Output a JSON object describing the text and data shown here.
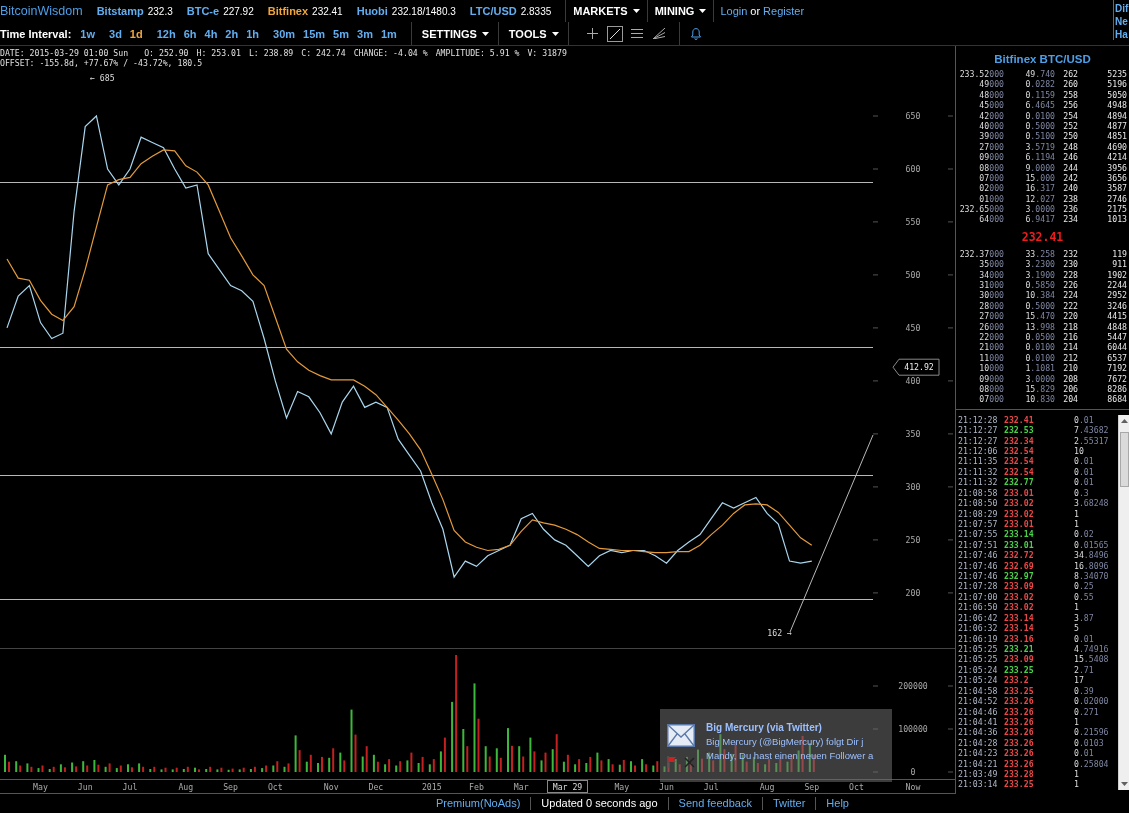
{
  "header": {
    "logo": "BitcoinWisdom",
    "markets": [
      {
        "name": "Bitstamp",
        "price": "232.3",
        "selected": false
      },
      {
        "name": "BTC-e",
        "price": "227.92",
        "selected": false
      },
      {
        "name": "Bitfinex",
        "price": "232.41",
        "selected": true
      },
      {
        "name": "Huobi",
        "price": "232.18/1480.3",
        "selected": false
      },
      {
        "name": "LTC/USD",
        "price": "2.8335",
        "selected": false
      }
    ],
    "menus": [
      "MARKETS",
      "MINING"
    ],
    "account": {
      "login": "Login",
      "or": "or",
      "register": "Register"
    }
  },
  "corner_panel": {
    "lines": [
      "Dif",
      "Ne",
      "Ha"
    ]
  },
  "toolbar": {
    "interval_label": "Time Interval:",
    "interval_groups": [
      [
        {
          "label": "1w",
          "selected": false
        }
      ],
      [
        {
          "label": "3d",
          "selected": false
        },
        {
          "label": "1d",
          "selected": true
        }
      ],
      [
        {
          "label": "12h",
          "selected": false
        },
        {
          "label": "6h",
          "selected": false
        },
        {
          "label": "4h",
          "selected": false
        },
        {
          "label": "2h",
          "selected": false
        },
        {
          "label": "1h",
          "selected": false
        }
      ],
      [
        {
          "label": "30m",
          "selected": false
        },
        {
          "label": "15m",
          "selected": false
        },
        {
          "label": "5m",
          "selected": false
        },
        {
          "label": "3m",
          "selected": false
        },
        {
          "label": "1m",
          "selected": false
        }
      ]
    ],
    "menus": [
      "SETTINGS",
      "TOOLS"
    ],
    "tools": [
      {
        "kind": "crosshair",
        "selected": false
      },
      {
        "kind": "line",
        "selected": true
      },
      {
        "kind": "hlines",
        "selected": false
      },
      {
        "kind": "fan",
        "selected": false
      }
    ]
  },
  "price_chart": {
    "info": [
      "DATE: 2015-03-29 01:00 Sun",
      "O: 252.90",
      "H: 253.01",
      "L: 238.89",
      "C: 242.74",
      "CHANGE: -4.04 %",
      "AMPLITUDE: 5.91 %",
      "V: 31879"
    ],
    "offset": "OFFSET: -155.8d, +77.67% / -43.72%, 180.5",
    "cursor_label": "412.92",
    "chart_data": {
      "type": "line",
      "categories": [
        null,
        null,
        null,
        null,
        null,
        null,
        null,
        null,
        null,
        null,
        null,
        null,
        null,
        null,
        null,
        null,
        null,
        null,
        null,
        null,
        null,
        null,
        null,
        null,
        null,
        null,
        null,
        null,
        null,
        null,
        null,
        null,
        null,
        null,
        null,
        null,
        null,
        null,
        null,
        null,
        null,
        null,
        null,
        null,
        null,
        null,
        null,
        null,
        null,
        null,
        null,
        null,
        null,
        null,
        null,
        null,
        null,
        null,
        null,
        null,
        null,
        null,
        null,
        null,
        null,
        null,
        null,
        null,
        null,
        null,
        null,
        null,
        null
      ],
      "series": [
        {
          "color": "#a9d6ee",
          "values": [
            450,
            480,
            490,
            455,
            440,
            445,
            560,
            640,
            650,
            600,
            585,
            600,
            630,
            625,
            620,
            600,
            582,
            585,
            520,
            505,
            490,
            485,
            475,
            440,
            400,
            365,
            390,
            385,
            370,
            350,
            380,
            395,
            375,
            380,
            375,
            345,
            330,
            315,
            285,
            260,
            215,
            230,
            225,
            235,
            240,
            245,
            270,
            275,
            260,
            250,
            245,
            235,
            225,
            235,
            240,
            238,
            240,
            240,
            235,
            228,
            240,
            248,
            255,
            270,
            285,
            280,
            285,
            290,
            275,
            265,
            230,
            228,
            230
          ]
        },
        {
          "color": "#e39a3c",
          "values": [
            515,
            497,
            495,
            476,
            463,
            457,
            470,
            505,
            545,
            585,
            590,
            592,
            605,
            612,
            618,
            617,
            603,
            597,
            585,
            560,
            535,
            518,
            500,
            490,
            460,
            430,
            418,
            410,
            405,
            401,
            401,
            401,
            395,
            387,
            375,
            363,
            350,
            335,
            312,
            288,
            259,
            248,
            243,
            240,
            241,
            245,
            258,
            269,
            266,
            264,
            260,
            255,
            248,
            242,
            241,
            240,
            240,
            239,
            238,
            238,
            239,
            239,
            245,
            255,
            264,
            275,
            283,
            284,
            283,
            276,
            264,
            252,
            245
          ]
        }
      ],
      "ylim": [
        200,
        650
      ],
      "yticks": [
        200,
        250,
        300,
        350,
        400,
        450,
        500,
        550,
        600,
        650
      ],
      "annotations": [
        "← 685",
        "162 →"
      ]
    }
  },
  "volume_chart": {
    "cursor_label": "Mar 29",
    "end_label": "Now",
    "chart_data": {
      "type": "bar",
      "categories": [
        null,
        null,
        null,
        "May",
        null,
        null,
        null,
        "Jun",
        null,
        null,
        null,
        "Jul",
        null,
        null,
        null,
        null,
        "Aug",
        null,
        null,
        null,
        "Sep",
        null,
        null,
        null,
        "Oct",
        null,
        null,
        null,
        null,
        "Nov",
        null,
        null,
        null,
        "Dec",
        null,
        null,
        null,
        null,
        "2015",
        null,
        null,
        null,
        "Feb",
        null,
        null,
        null,
        "Mar",
        null,
        null,
        null,
        null,
        null,
        null,
        null,
        null,
        "May",
        null,
        null,
        null,
        "Jun",
        null,
        null,
        null,
        "Jul",
        null,
        null,
        null,
        null,
        "Aug",
        null,
        null,
        null,
        "Sep",
        null,
        null,
        null,
        "Oct"
      ],
      "series": [
        {
          "color": "#3cb83c",
          "values": [
            40000,
            25000,
            20000,
            9000,
            7000,
            18000,
            22000,
            25000,
            28000,
            12000,
            9000,
            18000,
            20000,
            7000,
            6000,
            6000,
            7000,
            10000,
            7000,
            6000,
            5000,
            6000,
            7000,
            9000,
            15000,
            12000,
            85000,
            24000,
            21000,
            33000,
            45000,
            145000,
            36000,
            40000,
            18000,
            15000,
            27000,
            21000,
            18000,
            48000,
            163000,
            100000,
            206000,
            60000,
            55000,
            102000,
            60000,
            80000,
            27000,
            53000,
            24000,
            18000,
            21000,
            45000,
            30000,
            17000,
            25000,
            30000,
            15000,
            13000,
            30000,
            35000,
            52000,
            45000,
            88000,
            42000,
            40000,
            35000,
            18000,
            21000,
            24000,
            50000,
            67000,
            null,
            null,
            null,
            null
          ]
        },
        {
          "color": "#c42020",
          "values": [
            24000,
            15000,
            12000,
            15000,
            12000,
            11000,
            13000,
            15000,
            17000,
            20000,
            15000,
            11000,
            12000,
            12000,
            10000,
            10000,
            12000,
            6000,
            12000,
            10000,
            8000,
            10000,
            12000,
            15000,
            25000,
            20000,
            51000,
            40000,
            35000,
            55000,
            27000,
            87000,
            60000,
            24000,
            30000,
            25000,
            45000,
            35000,
            30000,
            80000,
            272000,
            60000,
            124000,
            36000,
            33000,
            61000,
            36000,
            48000,
            45000,
            88000,
            40000,
            30000,
            35000,
            27000,
            18000,
            28000,
            15000,
            18000,
            25000,
            22000,
            18000,
            21000,
            31000,
            27000,
            53000,
            70000,
            24000,
            21000,
            30000,
            35000,
            40000,
            84000,
            40000,
            null,
            null,
            null,
            null
          ]
        }
      ],
      "ylim": [
        0,
        286000
      ],
      "yticks": [
        {
          "value": 0,
          "label": "0"
        },
        {
          "value": 100000,
          "label": "100000"
        },
        {
          "value": 200000,
          "label": "200000"
        }
      ]
    }
  },
  "order_book": {
    "title": "Bitfinex BTC/USD",
    "asks": [
      {
        "column_1": [
          "233.52",
          "000"
        ],
        "column_2": [
          "49",
          ".740"
        ],
        "column_3": "262",
        "column_4": "5235"
      },
      {
        "column_1": [
          "49",
          "000"
        ],
        "column_2": [
          "0",
          ".0282"
        ],
        "column_3": "260",
        "column_4": "5196"
      },
      {
        "column_1": [
          "48",
          "000"
        ],
        "column_2": [
          "0",
          ".1159"
        ],
        "column_3": "258",
        "column_4": "5050"
      },
      {
        "column_1": [
          "45",
          "000"
        ],
        "column_2": [
          "6",
          ".4645"
        ],
        "column_3": "256",
        "column_4": "4948"
      },
      {
        "column_1": [
          "42",
          "000"
        ],
        "column_2": [
          "0",
          ".0100"
        ],
        "column_3": "254",
        "column_4": "4894"
      },
      {
        "column_1": [
          "40",
          "000"
        ],
        "column_2": [
          "0",
          ".5000"
        ],
        "column_3": "252",
        "column_4": "4877"
      },
      {
        "column_1": [
          "39",
          "000"
        ],
        "column_2": [
          "0",
          ".5100"
        ],
        "column_3": "250",
        "column_4": "4851"
      },
      {
        "column_1": [
          "27",
          "000"
        ],
        "column_2": [
          "3",
          ".5719"
        ],
        "column_3": "248",
        "column_4": "4690"
      },
      {
        "column_1": [
          "09",
          "000"
        ],
        "column_2": [
          "6",
          ".1194"
        ],
        "column_3": "246",
        "column_4": "4214"
      },
      {
        "column_1": [
          "08",
          "000"
        ],
        "column_2": [
          "9",
          ".0000"
        ],
        "column_3": "244",
        "column_4": "3956"
      },
      {
        "column_1": [
          "07",
          "000"
        ],
        "column_2": [
          "15",
          ".000"
        ],
        "column_3": "242",
        "column_4": "3656"
      },
      {
        "column_1": [
          "02",
          "000"
        ],
        "column_2": [
          "16",
          ".317"
        ],
        "column_3": "240",
        "column_4": "3587"
      },
      {
        "column_1": [
          "01",
          "000"
        ],
        "column_2": [
          "12",
          ".027"
        ],
        "column_3": "238",
        "column_4": "2746"
      },
      {
        "column_1": [
          "232.65",
          "000"
        ],
        "column_2": [
          "3",
          ".0000"
        ],
        "column_3": "236",
        "column_4": "2175"
      },
      {
        "column_1": [
          "64",
          "000"
        ],
        "column_2": [
          "6",
          ".9417"
        ],
        "column_3": "234",
        "column_4": "1013"
      }
    ],
    "last_price": "232.41",
    "bids": [
      {
        "column_1": [
          "232.37",
          "000"
        ],
        "column_2": [
          "33",
          ".258"
        ],
        "column_3": "232",
        "column_4": "119"
      },
      {
        "column_1": [
          "35",
          "000"
        ],
        "column_2": [
          "3",
          ".2300"
        ],
        "column_3": "230",
        "column_4": "911"
      },
      {
        "column_1": [
          "34",
          "000"
        ],
        "column_2": [
          "3",
          ".1900"
        ],
        "column_3": "228",
        "column_4": "1902"
      },
      {
        "column_1": [
          "31",
          "000"
        ],
        "column_2": [
          "0",
          ".5850"
        ],
        "column_3": "226",
        "column_4": "2244"
      },
      {
        "column_1": [
          "30",
          "000"
        ],
        "column_2": [
          "10",
          ".384"
        ],
        "column_3": "224",
        "column_4": "2952"
      },
      {
        "column_1": [
          "28",
          "000"
        ],
        "column_2": [
          "0",
          ".5000"
        ],
        "column_3": "222",
        "column_4": "3246"
      },
      {
        "column_1": [
          "27",
          "000"
        ],
        "column_2": [
          "15",
          ".470"
        ],
        "column_3": "220",
        "column_4": "4415"
      },
      {
        "column_1": [
          "26",
          "000"
        ],
        "column_2": [
          "13",
          ".998"
        ],
        "column_3": "218",
        "column_4": "4848"
      },
      {
        "column_1": [
          "22",
          "000"
        ],
        "column_2": [
          "0",
          ".0500"
        ],
        "column_3": "216",
        "column_4": "5447"
      },
      {
        "column_1": [
          "21",
          "000"
        ],
        "column_2": [
          "0",
          ".0100"
        ],
        "column_3": "214",
        "column_4": "6044"
      },
      {
        "column_1": [
          "11",
          "000"
        ],
        "column_2": [
          "0",
          ".0100"
        ],
        "column_3": "212",
        "column_4": "6537"
      },
      {
        "column_1": [
          "10",
          "000"
        ],
        "column_2": [
          "1",
          ".1081"
        ],
        "column_3": "210",
        "column_4": "7192"
      },
      {
        "column_1": [
          "09",
          "000"
        ],
        "column_2": [
          "3",
          ".0000"
        ],
        "column_3": "208",
        "column_4": "7672"
      },
      {
        "column_1": [
          "08",
          "000"
        ],
        "column_2": [
          "15",
          ".829"
        ],
        "column_3": "206",
        "column_4": "8286"
      },
      {
        "column_1": [
          "07",
          "000"
        ],
        "column_2": [
          "10",
          ".830"
        ],
        "column_3": "204",
        "column_4": "8684"
      }
    ]
  },
  "trades": [
    {
      "column_1": "21:12:28",
      "column_2": "232.41",
      "color": "#e84848",
      "column_3": [
        "0",
        ".01"
      ]
    },
    {
      "column_1": "21:12:27",
      "column_2": "232.53",
      "color": "#4cd04c",
      "column_3": [
        "7",
        ".43682"
      ]
    },
    {
      "column_1": "21:12:27",
      "column_2": "232.34",
      "color": "#e84848",
      "column_3": [
        "2",
        ".55317"
      ]
    },
    {
      "column_1": "21:12:06",
      "column_2": "232.54",
      "color": "#e84848",
      "column_3": [
        "10"
      ]
    },
    {
      "column_1": "21:11:35",
      "column_2": "232.54",
      "color": "#e84848",
      "column_3": [
        "0",
        ".01"
      ]
    },
    {
      "column_1": "21:11:32",
      "column_2": "232.54",
      "color": "#e84848",
      "column_3": [
        "0",
        ".01"
      ]
    },
    {
      "column_1": "21:11:32",
      "column_2": "232.77",
      "color": "#4cd04c",
      "column_3": [
        "0",
        ".01"
      ]
    },
    {
      "column_1": "21:08:58",
      "column_2": "233.01",
      "color": "#e84848",
      "column_3": [
        "0",
        ".3"
      ]
    },
    {
      "column_1": "21:08:50",
      "column_2": "233.02",
      "color": "#e84848",
      "column_3": [
        "3",
        ".68248"
      ]
    },
    {
      "column_1": "21:08:29",
      "column_2": "233.02",
      "color": "#e84848",
      "column_3": [
        "1"
      ]
    },
    {
      "column_1": "21:07:57",
      "column_2": "233.01",
      "color": "#e84848",
      "column_3": [
        "1"
      ]
    },
    {
      "column_1": "21:07:55",
      "column_2": "233.14",
      "color": "#4cd04c",
      "column_3": [
        "0",
        ".02"
      ]
    },
    {
      "column_1": "21:07:51",
      "column_2": "233.01",
      "color": "#4cd04c",
      "column_3": [
        "0",
        ".01565"
      ]
    },
    {
      "column_1": "21:07:46",
      "column_2": "232.72",
      "color": "#e84848",
      "column_3": [
        "34",
        ".8496"
      ]
    },
    {
      "column_1": "21:07:46",
      "column_2": "232.69",
      "color": "#e84848",
      "column_3": [
        "16",
        ".8096"
      ]
    },
    {
      "column_1": "21:07:46",
      "column_2": "232.97",
      "color": "#4cd04c",
      "column_3": [
        "8",
        ".34070"
      ]
    },
    {
      "column_1": "21:07:28",
      "column_2": "233.09",
      "color": "#e84848",
      "column_3": [
        "0",
        ".25"
      ]
    },
    {
      "column_1": "21:07:00",
      "column_2": "233.02",
      "color": "#e84848",
      "column_3": [
        "0",
        ".55"
      ]
    },
    {
      "column_1": "21:06:50",
      "column_2": "233.02",
      "color": "#e84848",
      "column_3": [
        "1"
      ]
    },
    {
      "column_1": "21:06:42",
      "column_2": "233.14",
      "color": "#e84848",
      "column_3": [
        "3",
        ".87"
      ]
    },
    {
      "column_1": "21:06:32",
      "column_2": "233.14",
      "color": "#e84848",
      "column_3": [
        "5"
      ]
    },
    {
      "column_1": "21:06:19",
      "column_2": "233.16",
      "color": "#e84848",
      "column_3": [
        "0",
        ".01"
      ]
    },
    {
      "column_1": "21:05:25",
      "column_2": "233.21",
      "color": "#4cd04c",
      "column_3": [
        "4",
        ".74916"
      ]
    },
    {
      "column_1": "21:05:25",
      "column_2": "233.09",
      "color": "#e84848",
      "column_3": [
        "15",
        ".5408"
      ]
    },
    {
      "column_1": "21:05:24",
      "column_2": "233.25",
      "color": "#4cd04c",
      "column_3": [
        "2",
        ".71"
      ]
    },
    {
      "column_1": "21:05:24",
      "column_2": "233.2",
      "color": "#e84848",
      "column_3": [
        "17"
      ]
    },
    {
      "column_1": "21:04:58",
      "column_2": "233.25",
      "color": "#e84848",
      "column_3": [
        "0",
        ".39"
      ]
    },
    {
      "column_1": "21:04:52",
      "column_2": "233.26",
      "color": "#e84848",
      "column_3": [
        "0",
        ".02000"
      ]
    },
    {
      "column_1": "21:04:46",
      "column_2": "233.26",
      "color": "#e84848",
      "column_3": [
        "0",
        ".271"
      ]
    },
    {
      "column_1": "21:04:41",
      "column_2": "233.26",
      "color": "#e84848",
      "column_3": [
        "1"
      ]
    },
    {
      "column_1": "21:04:36",
      "column_2": "233.26",
      "color": "#e84848",
      "column_3": [
        "0",
        ".21596"
      ]
    },
    {
      "column_1": "21:04:28",
      "column_2": "233.26",
      "color": "#e84848",
      "column_3": [
        "0",
        ".0103"
      ]
    },
    {
      "column_1": "21:04:23",
      "column_2": "233.26",
      "color": "#e84848",
      "column_3": [
        "0",
        ".01"
      ]
    },
    {
      "column_1": "21:04:21",
      "column_2": "233.26",
      "color": "#e84848",
      "column_3": [
        "0",
        ".25804"
      ]
    },
    {
      "column_1": "21:03:49",
      "column_2": "233.28",
      "color": "#e84848",
      "column_3": [
        "1"
      ]
    },
    {
      "column_1": "21:03:14",
      "column_2": "233.25",
      "color": "#e84848",
      "column_3": [
        "1"
      ]
    }
  ],
  "notification": {
    "title": "Big Mercury (via Twitter)",
    "lines": [
      "Big Mercury (@BigMercury) folgt Dir j",
      "Mandy, Du hast einen neuen Follower a"
    ]
  },
  "footer": [
    {
      "label": "Premium(NoAds)",
      "kind": "link"
    },
    {
      "label": "Updated 0 seconds ago",
      "kind": "status"
    },
    {
      "label": "Send feedback",
      "kind": "link"
    },
    {
      "label": "Twitter",
      "kind": "link"
    },
    {
      "label": "Help",
      "kind": "link"
    }
  ]
}
